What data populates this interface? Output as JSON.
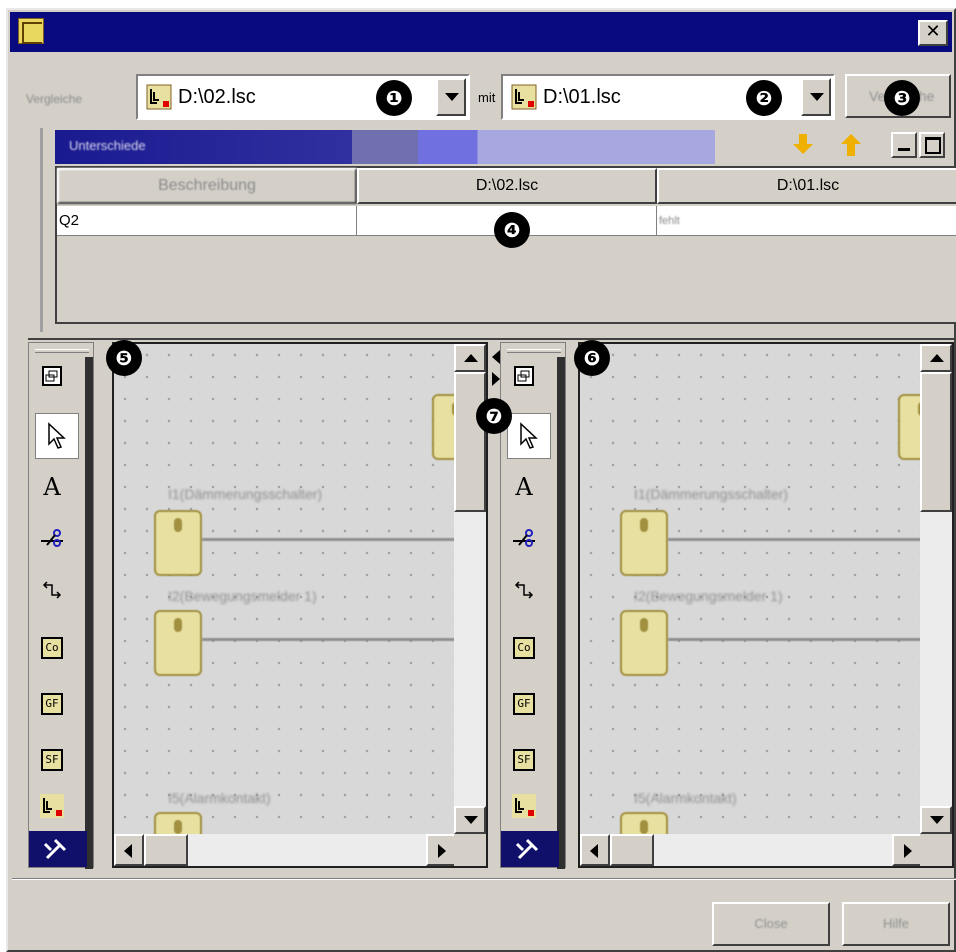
{
  "title_bar": {
    "close_glyph": "✕"
  },
  "compare": {
    "label": "Vergleiche",
    "left_file": "D:\\02.lsc",
    "mit_label": "mit",
    "right_file": "D:\\01.lsc",
    "compare_button": "Vergleiche"
  },
  "markers": [
    "❶",
    "❷",
    "❸",
    "❹",
    "❺",
    "❻",
    "❼"
  ],
  "differences": {
    "header": "Unterschiede",
    "columns": [
      "Beschreibung",
      "D:\\02.lsc",
      "D:\\01.lsc"
    ],
    "rows": [
      {
        "desc": "Q2",
        "left": "",
        "right": "fehlt"
      }
    ]
  },
  "left_pane": {
    "blocks": [
      {
        "label": "I1(Dämmerungsschalter)"
      },
      {
        "label": "I2(Bewegungsmelder 1)"
      },
      {
        "label": "I5(Alarmkontakt)"
      }
    ]
  },
  "right_pane": {
    "blocks": [
      {
        "label": "I1(Dämmerungsschalter)"
      },
      {
        "label": "I2(Bewegungsmelder 1)"
      },
      {
        "label": "I5(Alarmkontakt)"
      }
    ]
  },
  "toolbar": {
    "tools": [
      "window-tile-icon",
      "pointer-icon",
      "text-icon",
      "cut-wire-icon",
      "connect-icon",
      "Co",
      "GF",
      "SF",
      "program-icon",
      "simulation-icon"
    ],
    "co_label": "Co",
    "gf_label": "GF",
    "sf_label": "SF",
    "text_glyph": "A"
  },
  "footer": {
    "close_button": "Close",
    "help_button": "Hilfe"
  }
}
